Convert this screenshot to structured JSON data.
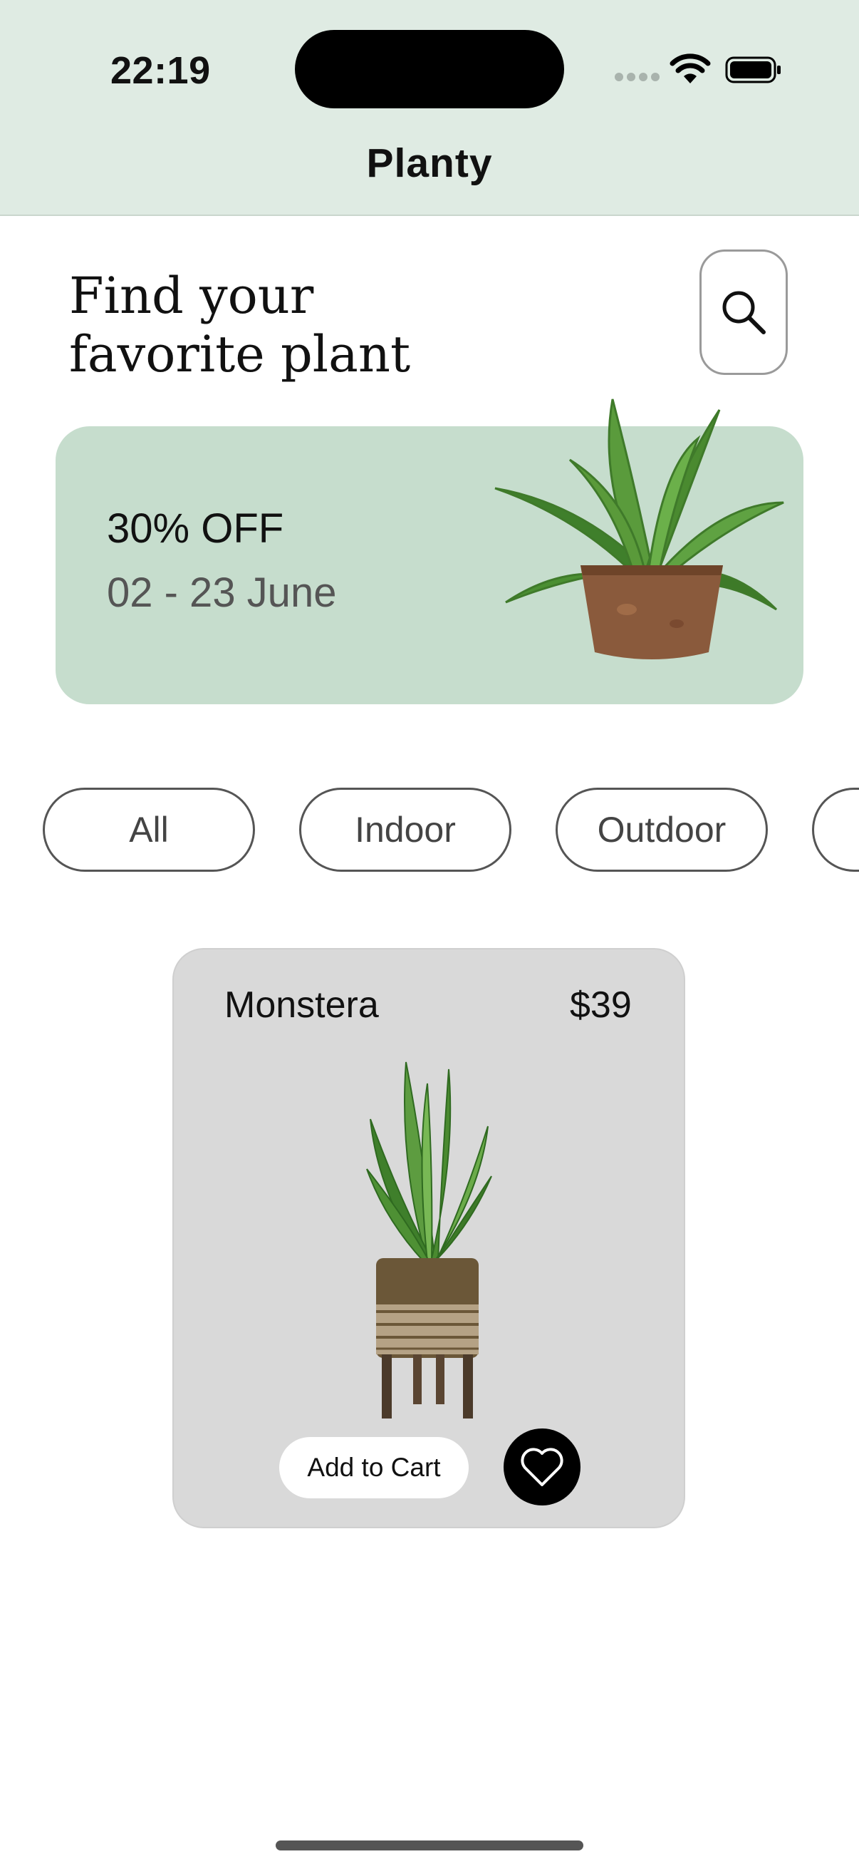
{
  "status_bar": {
    "time": "22:19"
  },
  "app": {
    "title": "Planty"
  },
  "hero": {
    "heading": "Find your\nfavorite plant"
  },
  "promo": {
    "discount": "30% OFF",
    "dates": "02 - 23 June"
  },
  "categories": [
    "All",
    "Indoor",
    "Outdoor"
  ],
  "product": {
    "name": "Monstera",
    "price": "$39",
    "add_to_cart": "Add to Cart"
  },
  "colors": {
    "header_bg": "#dfebe3",
    "promo_bg": "#c6ddcd",
    "card_bg": "#d9d9d9"
  },
  "icons": {
    "search": "search-icon",
    "favorite": "heart-icon"
  }
}
